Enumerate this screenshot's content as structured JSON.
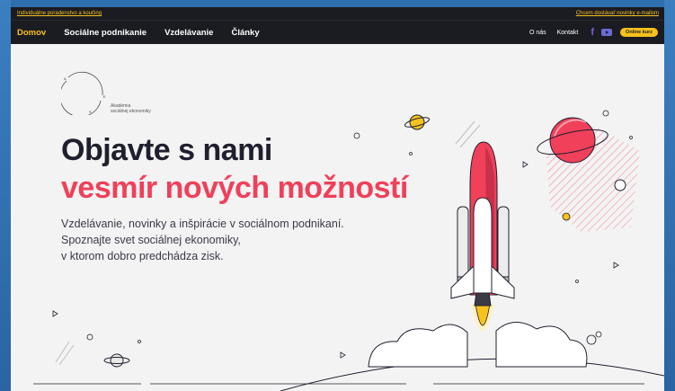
{
  "topbar": {
    "left_link": "Individuálne poradenstvo a koučing",
    "right_link": "Chcem dostávať novinky e-mailom"
  },
  "nav": {
    "items": [
      "Domov",
      "Sociálne podnikanie",
      "Vzdelávanie",
      "Články"
    ],
    "about": "O nás",
    "contact": "Kontakt",
    "cta": "Online kurz"
  },
  "logo": {
    "letters": [
      "A",
      "E",
      "S"
    ],
    "line1": "Akadémia",
    "line2": "sociálnej ekonomiky"
  },
  "hero": {
    "title_line1": "Objavte s nami",
    "title_line2": "vesmír nových možností",
    "subtitle_lines": [
      "Vzdelávanie, novinky a inšpirácie v sociálnom podnikaní.",
      "Spoznajte svet sociálnej ekonomiky,",
      "v ktorom dobro predchádza zisk."
    ]
  },
  "colors": {
    "accent_red": "#f0405a",
    "accent_yellow": "#f7c21c",
    "dark": "#1b1b22"
  }
}
